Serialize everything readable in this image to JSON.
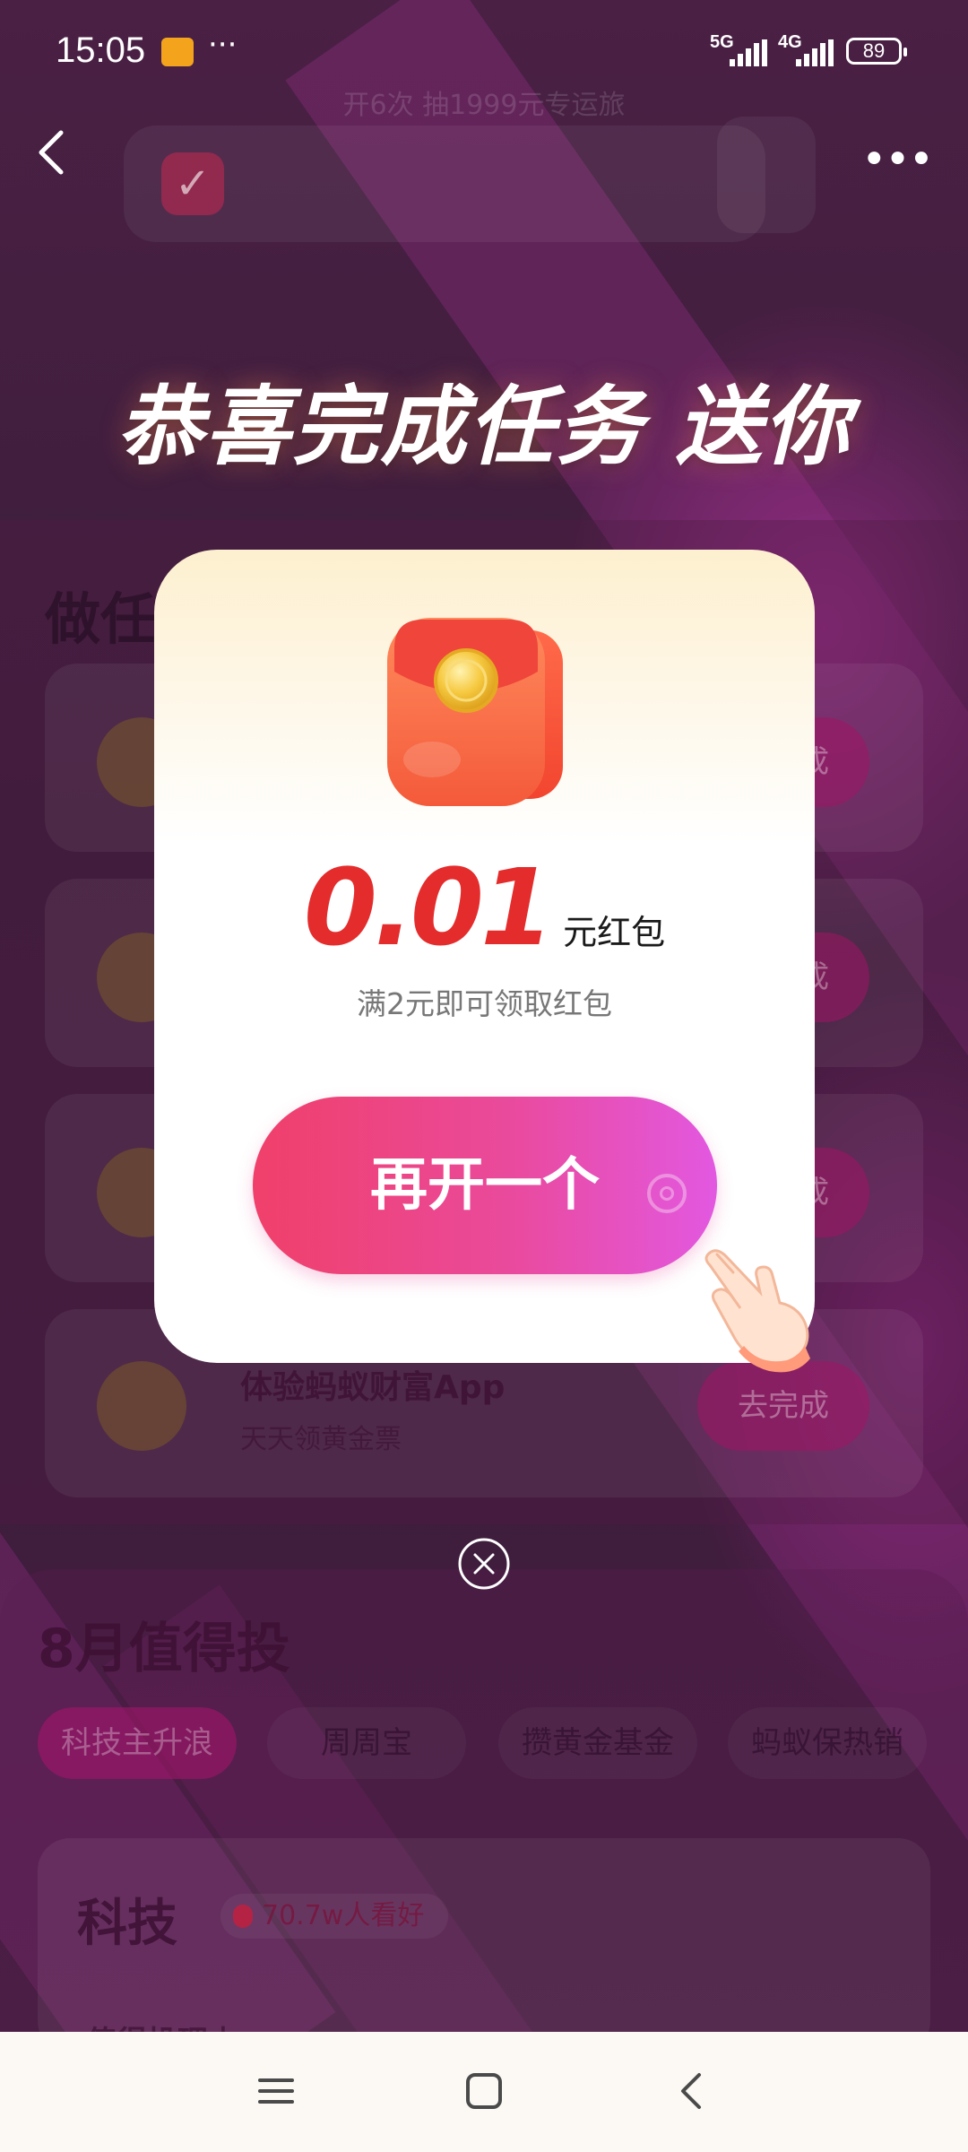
{
  "status_bar": {
    "time": "15:05",
    "more": "···",
    "net1": "5G",
    "net2": "4G",
    "battery": "89"
  },
  "nav": {
    "more": "•••"
  },
  "background": {
    "header_text": "开6次 抽1999元专运旅",
    "check_mark": "✓",
    "section_title": "做任",
    "task_button": "去完成",
    "task_title": "体验蚂蚁财富App",
    "task_subtitle": "天天领黄金票",
    "invest_title": "8月值得投",
    "chips": [
      "科技主升浪",
      "周周宝",
      "攒黄金基金",
      "蚂蚁保热销"
    ],
    "sub_title": "科技",
    "sub_badge": "70.7w人看好",
    "bottom_text": "值得投理由"
  },
  "overlay": {
    "headline": "恭喜完成任务 送你",
    "amount": "0.01",
    "amount_unit": "元红包",
    "hint": "满2元即可领取红包",
    "cta_label": "再开一个"
  },
  "colors": {
    "accent_red": "#e42c2c",
    "cta_start": "#f0406a",
    "cta_end": "#e258e0"
  },
  "icons": {
    "envelope": "red-envelope-icon",
    "hand": "pointing-hand-icon",
    "close": "close-circle-icon",
    "back": "chevron-left-icon",
    "menu": "menu-icon",
    "home": "square-home-icon",
    "sys_back": "back-triangle-icon"
  }
}
